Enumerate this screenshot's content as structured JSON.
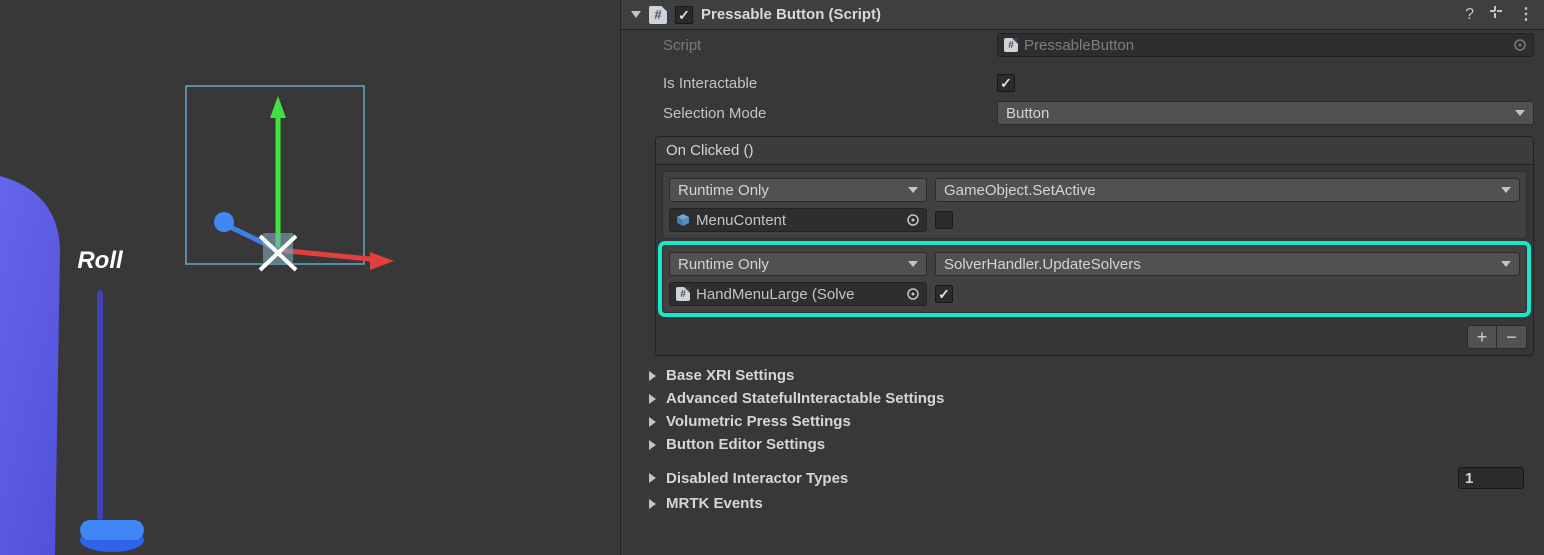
{
  "scene": {
    "label": "Roll"
  },
  "component": {
    "title": "Pressable Button (Script)",
    "enabled": true,
    "script_label": "Script",
    "script_value": "PressableButton",
    "is_interactable_label": "Is Interactable",
    "is_interactable_value": true,
    "selection_mode_label": "Selection Mode",
    "selection_mode_value": "Button"
  },
  "unity_event": {
    "title": "On Clicked ()",
    "entries": [
      {
        "call_state": "Runtime Only",
        "function": "GameObject.SetActive",
        "target": "MenuContent",
        "target_icon": "prefab-cube",
        "bool_arg": false
      },
      {
        "call_state": "Runtime Only",
        "function": "SolverHandler.UpdateSolvers",
        "target": "HandMenuLarge (Solve",
        "target_icon": "script",
        "bool_arg": true
      }
    ],
    "add_label": "+",
    "remove_label": "−"
  },
  "foldouts": {
    "base_xri": "Base XRI Settings",
    "advanced_stateful": "Advanced StatefulInteractable Settings",
    "volumetric": "Volumetric Press Settings",
    "button_editor": "Button Editor Settings",
    "disabled_interactor": "Disabled Interactor Types",
    "disabled_interactor_count": "1",
    "mrtk_events": "MRTK Events"
  }
}
